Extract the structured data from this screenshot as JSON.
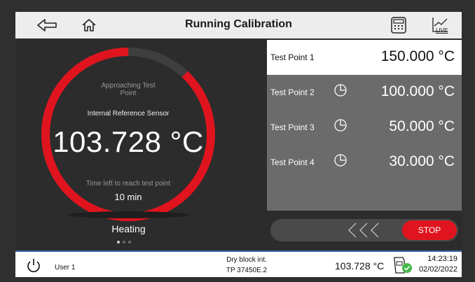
{
  "header": {
    "title": "Running Calibration",
    "back_icon": "back-arrow-icon",
    "home_icon": "home-icon",
    "keypad_icon": "calculator-icon",
    "live_icon": "live-chart-icon",
    "live_label": "LIVE"
  },
  "gauge": {
    "approaching": "Approaching Test Point",
    "sensor_label": "Internal Reference Sensor",
    "temperature": "103.728 °C",
    "time_left_label": "Time left to reach test point",
    "time_left_value": "10 min",
    "progress_fraction": 0.88,
    "accent_color": "#e0141e"
  },
  "state": {
    "label": "Heating",
    "page_count": 3,
    "active_page": 0
  },
  "test_points": [
    {
      "label": "Test Point 1",
      "value": "150.000 °C",
      "active": true,
      "clock": false
    },
    {
      "label": "Test Point 2",
      "value": "100.000 °C",
      "active": false,
      "clock": true
    },
    {
      "label": "Test Point 3",
      "value": "50.000 °C",
      "active": false,
      "clock": true
    },
    {
      "label": "Test Point 4",
      "value": "30.000 °C",
      "active": false,
      "clock": true
    }
  ],
  "controls": {
    "chevrons": "<<<",
    "stop_label": "STOP"
  },
  "status_bar": {
    "user": "User 1",
    "device_line1": "Dry block int.",
    "device_line2": "TP 37450E.2",
    "temperature": "103.728 °C",
    "time": "14:23:19",
    "date": "02/02/2022",
    "ok_color": "#46b84a"
  }
}
